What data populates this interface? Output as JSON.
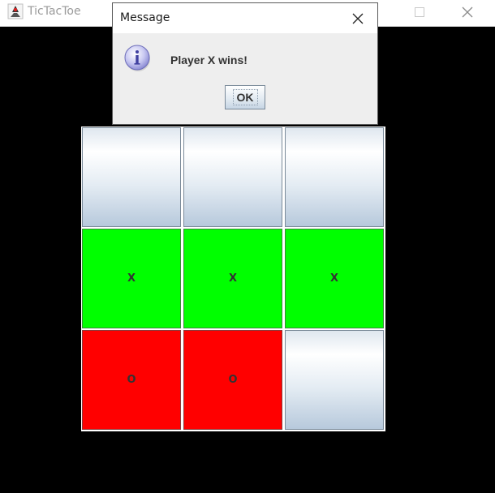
{
  "window": {
    "title": "TicTacToe",
    "icon": "java-duke-icon"
  },
  "board": {
    "cells": [
      {
        "mark": "",
        "state": "empty"
      },
      {
        "mark": "",
        "state": "empty"
      },
      {
        "mark": "",
        "state": "empty"
      },
      {
        "mark": "X",
        "state": "x"
      },
      {
        "mark": "X",
        "state": "x"
      },
      {
        "mark": "X",
        "state": "x"
      },
      {
        "mark": "O",
        "state": "o"
      },
      {
        "mark": "O",
        "state": "o"
      },
      {
        "mark": "",
        "state": "empty"
      }
    ],
    "colors": {
      "x_win": "#00ff00",
      "o": "#ff0000",
      "background": "#000000"
    }
  },
  "dialog": {
    "title": "Message",
    "icon": "info-icon",
    "message": "Player X wins!",
    "ok_label": "OK"
  }
}
